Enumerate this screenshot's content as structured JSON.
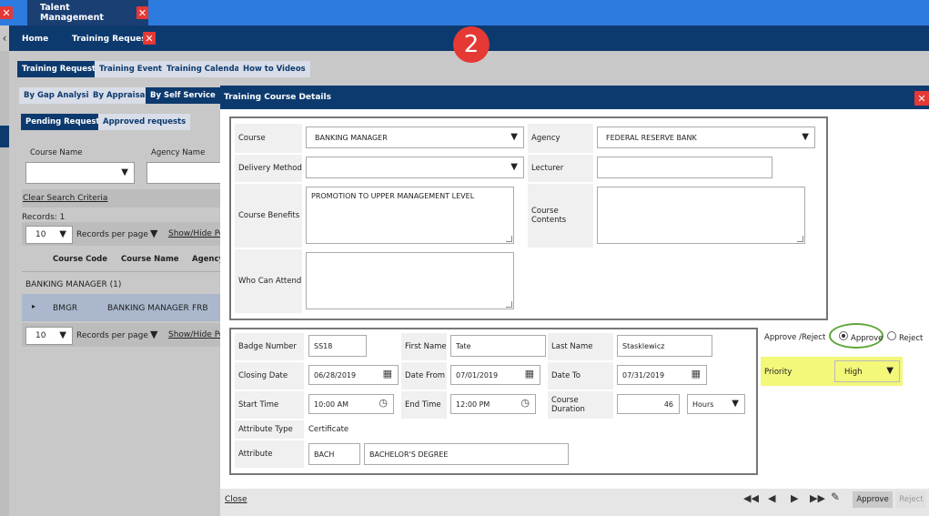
{
  "topbar": {
    "tab_label": "Talent Management"
  },
  "nav": {
    "home": "Home",
    "training_requests": "Training Requests"
  },
  "step_badge": "2",
  "subnav": {
    "tabs": [
      "Training Requests",
      "Training Events",
      "Training Calendar",
      "How to Videos"
    ],
    "filters": [
      "By Gap Analysis",
      "By Appraisal",
      "By Self Service"
    ],
    "request_tabs": [
      "Pending Requests",
      "Approved requests"
    ]
  },
  "search": {
    "course_name_label": "Course Name",
    "agency_name_label": "Agency Name",
    "clear_link": "Clear Search Criteria",
    "records_count": "Records:  1"
  },
  "grid": {
    "page_size": "10",
    "records_per_page": "Records per page",
    "show_hide": "Show/Hide Po",
    "columns": [
      "Course Code",
      "Course Name",
      "Agency"
    ],
    "group_label": "BANKING MANAGER  (1)",
    "row": {
      "code": "BMGR",
      "name": "BANKING MANAGER",
      "agency": "FRB"
    }
  },
  "modal": {
    "title": "Training Course Details",
    "course": {
      "course_label": "Course",
      "course_value": "BANKING MANAGER",
      "agency_label": "Agency",
      "agency_value": "FEDERAL RESERVE BANK",
      "delivery_label": "Delivery Method",
      "delivery_value": "",
      "lecturer_label": "Lecturer",
      "lecturer_value": "",
      "benefits_label": "Course Benefits",
      "benefits_value": "PROMOTION TO UPPER MANAGEMENT LEVEL",
      "contents_label": "Course Contents",
      "contents_value": "",
      "attend_label": "Who Can Attend",
      "attend_value": ""
    },
    "employee": {
      "badge_label": "Badge Number",
      "badge_value": "SS18",
      "first_label": "First Name",
      "first_value": "Tate",
      "last_label": "Last Name",
      "last_value": "Stasklewicz",
      "closing_label": "Closing Date",
      "closing_value": "06/28/2019",
      "from_label": "Date From",
      "from_value": "07/01/2019",
      "to_label": "Date To",
      "to_value": "07/31/2019",
      "start_label": "Start Time",
      "start_value": "10:00 AM",
      "end_label": "End Time",
      "end_value": "12:00 PM",
      "duration_label": "Course Duration",
      "duration_value": "46",
      "duration_unit": "Hours",
      "attr_type_label": "Attribute Type",
      "attr_type_value": "Certificate",
      "attr_label": "Attribute",
      "attr_code": "BACH",
      "attr_desc": "BACHELOR'S DEGREE"
    },
    "decision": {
      "label": "Approve /Reject",
      "approve": "Approve",
      "reject": "Reject",
      "selected": "approve",
      "priority_label": "Priority",
      "priority_value": "High"
    },
    "footer": {
      "close": "Close",
      "approve_btn": "Approve",
      "reject_btn": "Reject"
    }
  },
  "colors": {
    "navy": "#0d3a6e",
    "topbar_blue": "#2e7be0",
    "close_red": "#e53935",
    "highlight_yellow": "#f3f77a",
    "circle_green": "#5fa53a"
  }
}
